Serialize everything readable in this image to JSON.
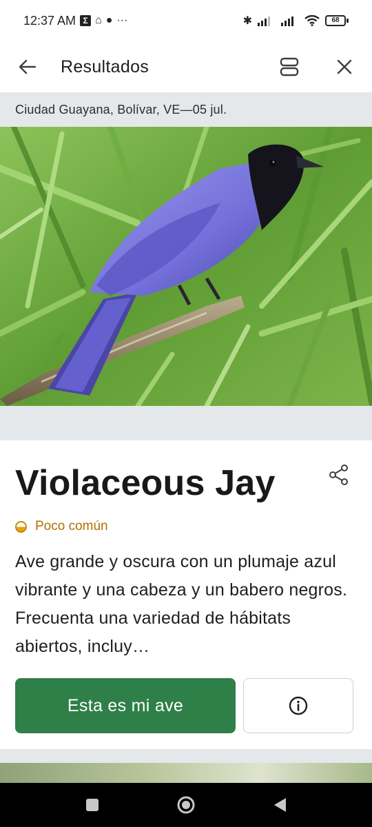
{
  "status_bar": {
    "time": "12:37 AM",
    "battery": "68"
  },
  "app_bar": {
    "title": "Resultados"
  },
  "location_line": "Ciudad Guayana, Bolívar, VE—05 jul.",
  "result": {
    "name": "Violaceous Jay",
    "rarity": "Poco común",
    "description": "Ave grande y oscura con un plumaje azul vibrante y una cabeza y un babero negros. Frecuenta una variedad de hábitats abiertos, incluy…",
    "primary_button": "Esta es mi ave"
  },
  "colors": {
    "accent": "#2f7f48",
    "rarity": "#b06f00",
    "background": "#e4e8ea"
  },
  "icons": {
    "back": "arrow-left-icon",
    "layout": "layout-toggle-icon",
    "close": "close-icon",
    "share": "share-icon",
    "info": "info-icon"
  }
}
